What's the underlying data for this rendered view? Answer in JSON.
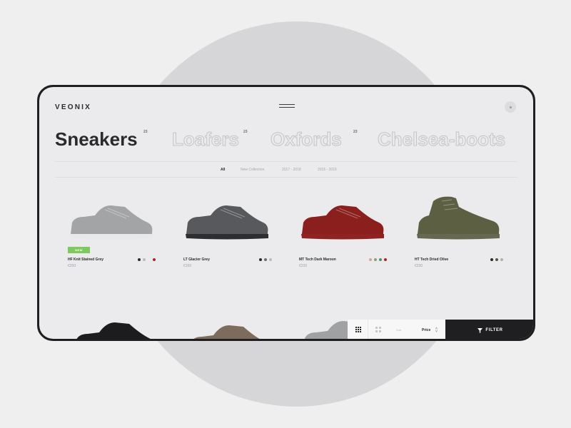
{
  "brand": "VEONIX",
  "categories": [
    {
      "name": "Sneakers",
      "count": "23"
    },
    {
      "name": "Loafers",
      "count": "23"
    },
    {
      "name": "Oxfords",
      "count": "23"
    },
    {
      "name": "Chelsea-boots"
    }
  ],
  "filter_tabs": [
    "All",
    "New Collection",
    "2017 - 2018",
    "2015 - 2016"
  ],
  "products": [
    {
      "name": "HF Knit Stained Grey",
      "price": "€250",
      "badge": "NEW",
      "color": "#a2a4a6",
      "sole": "#e9e9ea",
      "swatches": [
        "#2a2a2d",
        "#bcbcc0",
        "#ededef",
        "#a32a23"
      ]
    },
    {
      "name": "LT Glacier Grey",
      "price": "€160",
      "color": "#58595c",
      "sole": "#2e2e31",
      "swatches": [
        "#2a2a2d",
        "#6b6b70",
        "#b9b9be"
      ]
    },
    {
      "name": "MT Tech Dark Maroon",
      "price": "€220",
      "color": "#8b1f1d",
      "sole": "#8f2321",
      "swatches": [
        "#d8a39a",
        "#8a9c78",
        "#5e8a72",
        "#a32a23"
      ]
    },
    {
      "name": "HT Tech Dried Olive",
      "price": "€230",
      "color": "#5d5f43",
      "sole": "#666850",
      "swatches": [
        "#2a2a2d",
        "#55564a",
        "#b1b1a8"
      ]
    }
  ],
  "peek_products": [
    {
      "color": "#1c1c1e",
      "sole": "#1c1c1e"
    },
    {
      "color": "#7d6c5c",
      "sole": "#8c7b6b"
    },
    {
      "color": "#9fa1a3",
      "sole": "#b0b2b4"
    }
  ],
  "toolbar": {
    "sort_label": "Sort",
    "sort_value": "Price",
    "filter_label": "FILTER"
  },
  "icons": {
    "menu": "hamburger-icon",
    "account": "user-icon",
    "grid_dense": "grid-3x3-icon",
    "grid_large": "grid-2x2-icon",
    "filter": "funnel-icon",
    "sort": "chevron-updown-icon"
  },
  "colors": {
    "accent_new": "#7dc95e",
    "dark": "#1f1f22",
    "screen": "#ebebed"
  }
}
